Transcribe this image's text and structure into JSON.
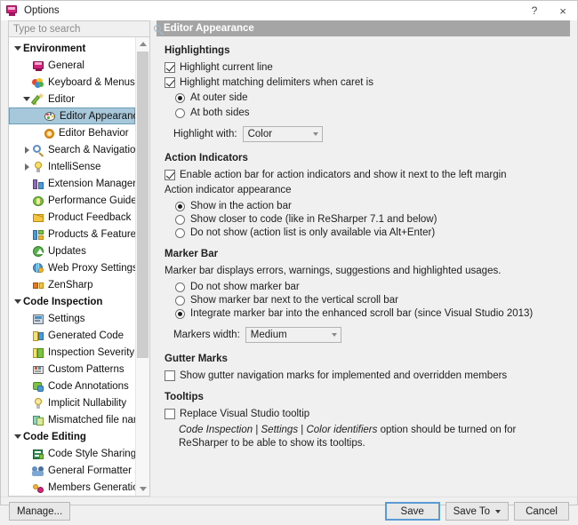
{
  "window": {
    "title": "Options",
    "icon": "options-icon",
    "help_label": "?",
    "close_label": "×"
  },
  "search": {
    "placeholder": "Type to search",
    "value": "",
    "icon": "search-icon"
  },
  "tree": {
    "items": [
      {
        "label": "Environment",
        "level": 0,
        "twist": "open",
        "icon": "none",
        "group": true,
        "selected": false
      },
      {
        "label": "General",
        "level": 1,
        "twist": "none",
        "icon": "i-monitor",
        "group": false,
        "selected": false
      },
      {
        "label": "Keyboard & Menus",
        "level": 1,
        "twist": "none",
        "icon": "i-keyboard",
        "group": false,
        "selected": false
      },
      {
        "label": "Editor",
        "level": 1,
        "twist": "open",
        "icon": "i-pencil",
        "group": false,
        "selected": false
      },
      {
        "label": "Editor Appearance",
        "level": 2,
        "twist": "none",
        "icon": "i-palette",
        "group": false,
        "selected": true
      },
      {
        "label": "Editor Behavior",
        "level": 2,
        "twist": "none",
        "icon": "i-gear",
        "group": false,
        "selected": false
      },
      {
        "label": "Search & Navigation",
        "level": 1,
        "twist": "closed",
        "icon": "i-magnify",
        "group": false,
        "selected": false
      },
      {
        "label": "IntelliSense",
        "level": 1,
        "twist": "closed",
        "icon": "i-bulb",
        "group": false,
        "selected": false
      },
      {
        "label": "Extension Manager",
        "level": 1,
        "twist": "none",
        "icon": "i-ext",
        "group": false,
        "selected": false
      },
      {
        "label": "Performance Guide",
        "level": 1,
        "twist": "none",
        "icon": "i-perf",
        "group": false,
        "selected": false
      },
      {
        "label": "Product Feedback",
        "level": 1,
        "twist": "none",
        "icon": "i-mail",
        "group": false,
        "selected": false
      },
      {
        "label": "Products & Features",
        "level": 1,
        "twist": "none",
        "icon": "i-prod",
        "group": false,
        "selected": false
      },
      {
        "label": "Updates",
        "level": 1,
        "twist": "none",
        "icon": "i-update",
        "group": false,
        "selected": false
      },
      {
        "label": "Web Proxy Settings",
        "level": 1,
        "twist": "none",
        "icon": "i-globe",
        "group": false,
        "selected": false
      },
      {
        "label": "ZenSharp",
        "level": 1,
        "twist": "none",
        "icon": "i-zen",
        "group": false,
        "selected": false
      },
      {
        "label": "Code Inspection",
        "level": 0,
        "twist": "open",
        "icon": "none",
        "group": true,
        "selected": false
      },
      {
        "label": "Settings",
        "level": 1,
        "twist": "none",
        "icon": "i-settings",
        "group": false,
        "selected": false
      },
      {
        "label": "Generated Code",
        "level": 1,
        "twist": "none",
        "icon": "i-gencode",
        "group": false,
        "selected": false
      },
      {
        "label": "Inspection Severity",
        "level": 1,
        "twist": "none",
        "icon": "i-sev",
        "group": false,
        "selected": false
      },
      {
        "label": "Custom Patterns",
        "level": 1,
        "twist": "none",
        "icon": "i-pattern",
        "group": false,
        "selected": false
      },
      {
        "label": "Code Annotations",
        "level": 1,
        "twist": "none",
        "icon": "i-annot",
        "group": false,
        "selected": false
      },
      {
        "label": "Implicit Nullability",
        "level": 1,
        "twist": "none",
        "icon": "i-null",
        "group": false,
        "selected": false
      },
      {
        "label": "Mismatched file names",
        "level": 1,
        "twist": "none",
        "icon": "i-mismatch",
        "group": false,
        "selected": false
      },
      {
        "label": "Code Editing",
        "level": 0,
        "twist": "open",
        "icon": "none",
        "group": true,
        "selected": false
      },
      {
        "label": "Code Style Sharing",
        "level": 1,
        "twist": "none",
        "icon": "i-share",
        "group": false,
        "selected": false
      },
      {
        "label": "General Formatter Style",
        "level": 1,
        "twist": "none",
        "icon": "i-format",
        "group": false,
        "selected": false
      },
      {
        "label": "Members Generation",
        "level": 1,
        "twist": "none",
        "icon": "i-members",
        "group": false,
        "selected": false
      }
    ]
  },
  "panel": {
    "header": "Editor Appearance",
    "highlightings": {
      "title": "Highlightings",
      "cb_current_line": "Highlight current line",
      "cb_matching_delims": "Highlight matching delimiters when caret is",
      "rb_outer_side": "At outer side",
      "rb_both_sides": "At both sides",
      "highlight_with_label": "Highlight with:",
      "highlight_with_value": "Color"
    },
    "action_indicators": {
      "title": "Action Indicators",
      "cb_enable_action_bar": "Enable action bar for action indicators and show it next to the left margin",
      "appearance_label": "Action indicator appearance",
      "rb_show_action_bar": "Show in the action bar",
      "rb_show_closer": "Show closer to code (like in ReSharper 7.1 and below)",
      "rb_do_not_show": "Do not show (action list is only available via Alt+Enter)"
    },
    "marker_bar": {
      "title": "Marker Bar",
      "description": "Marker bar displays errors, warnings, suggestions and highlighted usages.",
      "rb_do_not_show": "Do not show marker bar",
      "rb_next_to_scroll": "Show marker bar next to the vertical scroll bar",
      "rb_integrate": "Integrate marker bar into the enhanced scroll bar (since Visual Studio 2013)",
      "markers_width_label": "Markers width:",
      "markers_width_value": "Medium"
    },
    "gutter_marks": {
      "title": "Gutter Marks",
      "cb_show_gutter": "Show gutter navigation marks for implemented and overridden members"
    },
    "tooltips": {
      "title": "Tooltips",
      "cb_replace_tooltip": "Replace Visual Studio tooltip",
      "note_italic_1": "Code Inspection",
      "note_sep_1": " | ",
      "note_italic_2": "Settings",
      "note_sep_2": " | ",
      "note_italic_3": "Color identifiers",
      "note_rest": " option should be turned on for ReSharper to be able to show its tooltips."
    }
  },
  "footer": {
    "manage": "Manage...",
    "save": "Save",
    "save_to": "Save To",
    "cancel": "Cancel"
  }
}
